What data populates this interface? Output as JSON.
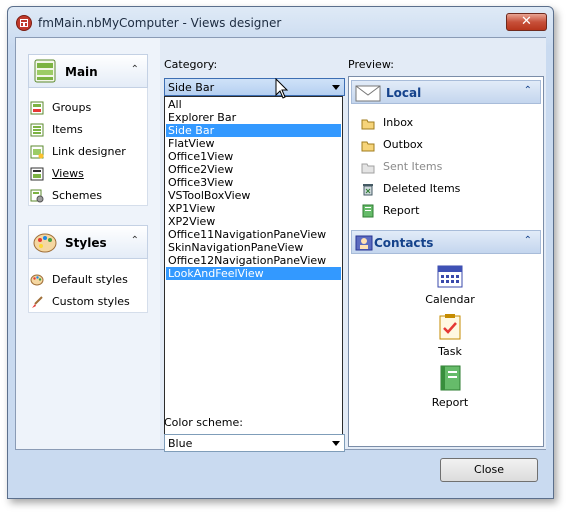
{
  "window": {
    "title": "fmMain.nbMyComputer  - Views designer",
    "close_glyph": "✕"
  },
  "navbar": {
    "groups": [
      {
        "caption": "Main",
        "icon": "main-group-icon",
        "items": [
          {
            "label": "Groups",
            "icon": "groups-icon"
          },
          {
            "label": "Items",
            "icon": "items-icon"
          },
          {
            "label": "Link designer",
            "icon": "link-designer-icon"
          },
          {
            "label": "Views",
            "icon": "views-icon"
          },
          {
            "label": "Schemes",
            "icon": "schemes-icon"
          }
        ]
      },
      {
        "caption": "Styles",
        "icon": "styles-group-icon",
        "items": [
          {
            "label": "Default styles",
            "icon": "palette-icon"
          },
          {
            "label": "Custom styles",
            "icon": "brush-icon"
          }
        ]
      }
    ],
    "chevron": "⌃"
  },
  "designer": {
    "category_label": "Category:",
    "category_value": "Side Bar",
    "category_options": [
      "All",
      "Explorer Bar",
      "Side Bar",
      "FlatView",
      "Office1View",
      "Office2View",
      "Office3View",
      "VSToolBoxView",
      "XP1View",
      "XP2View",
      "Office11NavigationPaneView",
      "SkinNavigationPaneView",
      "Office12NavigationPaneView",
      "LookAndFeelView"
    ],
    "highlighted_options": [
      "Side Bar",
      "LookAndFeelView"
    ],
    "color_scheme_label": "Color scheme:",
    "color_scheme_value": "Blue"
  },
  "preview": {
    "label": "Preview:",
    "groups": [
      {
        "caption": "Local",
        "icon": "envelope-icon",
        "items": [
          {
            "label": "Inbox",
            "icon": "inbox-icon",
            "disabled": false
          },
          {
            "label": "Outbox",
            "icon": "outbox-icon",
            "disabled": false
          },
          {
            "label": "Sent Items",
            "icon": "sent-items-icon",
            "disabled": true
          },
          {
            "label": "Deleted Items",
            "icon": "trash-icon",
            "disabled": false
          },
          {
            "label": "Report",
            "icon": "report-icon",
            "disabled": false
          }
        ]
      },
      {
        "caption": "Contacts",
        "icon": "contacts-icon",
        "items": [
          {
            "label": "Calendar",
            "icon": "calendar-icon"
          },
          {
            "label": "Task",
            "icon": "task-icon"
          },
          {
            "label": "Report",
            "icon": "notebook-icon"
          }
        ]
      }
    ]
  },
  "buttons": {
    "close_label": "Close"
  },
  "colors": {
    "selection": "#3399ff",
    "header_text": "#15428b",
    "title_close": "#c7503a"
  }
}
